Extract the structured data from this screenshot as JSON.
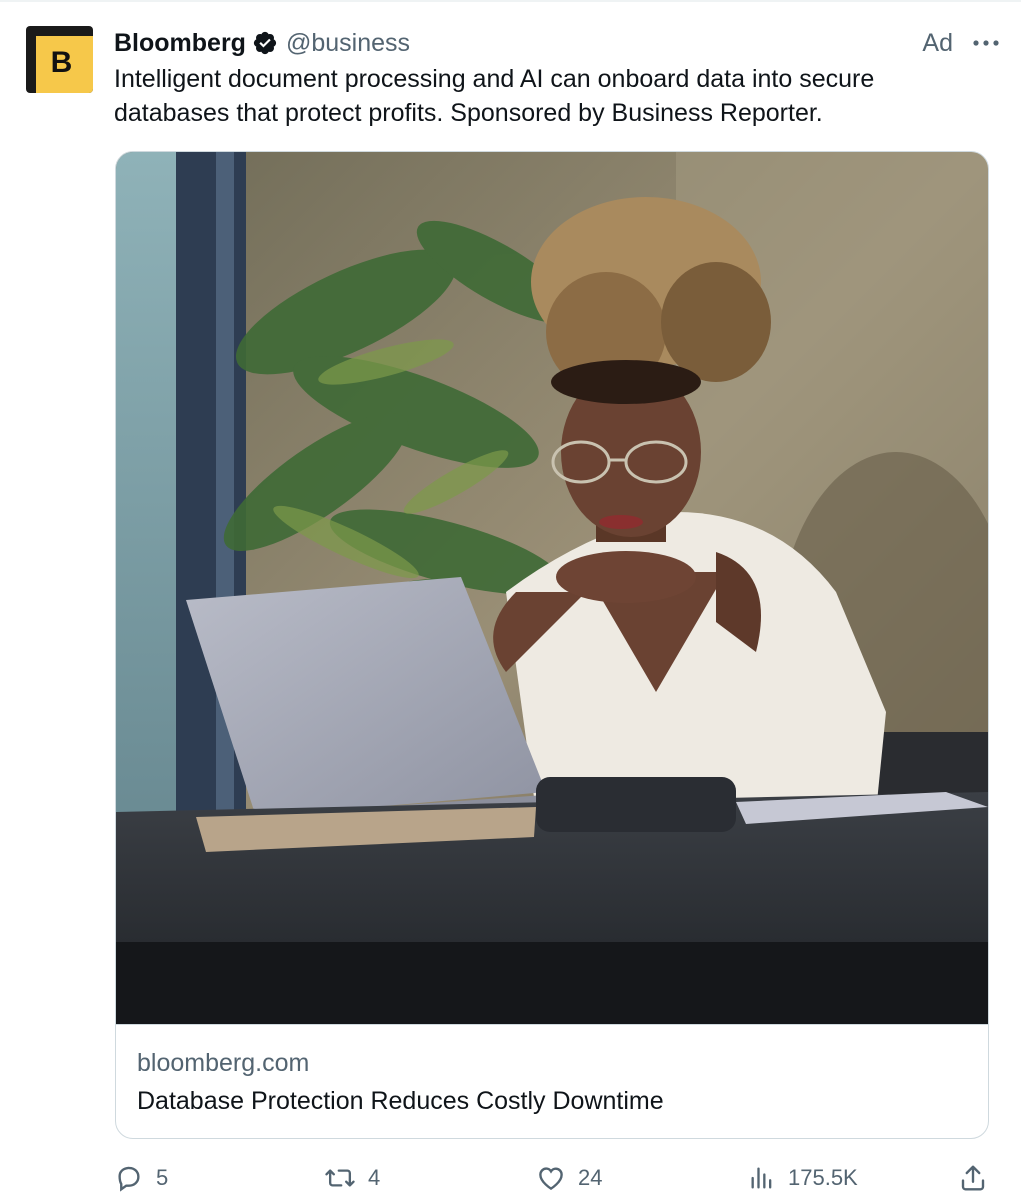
{
  "tweet": {
    "author_name": "Bloomberg",
    "author_handle": "@business",
    "avatar_letter": "B",
    "ad_label": "Ad",
    "text": "Intelligent document processing and AI can onboard data into secure databases that protect profits. Sponsored by Business Reporter."
  },
  "card": {
    "domain": "bloomberg.com",
    "title": "Database Protection Reduces Costly Downtime"
  },
  "actions": {
    "replies": "5",
    "reposts": "4",
    "likes": "24",
    "views": "175.5K"
  },
  "icons": {
    "verified": "verified-badge-icon",
    "more": "more-dots-icon",
    "reply": "reply-icon",
    "repost": "repost-icon",
    "like": "heart-icon",
    "views": "views-bar-chart-icon",
    "share": "share-icon"
  },
  "colors": {
    "text_primary": "#0f1419",
    "text_secondary": "#536471",
    "border": "#cfd9de",
    "avatar_yellow": "#f6c84a"
  }
}
